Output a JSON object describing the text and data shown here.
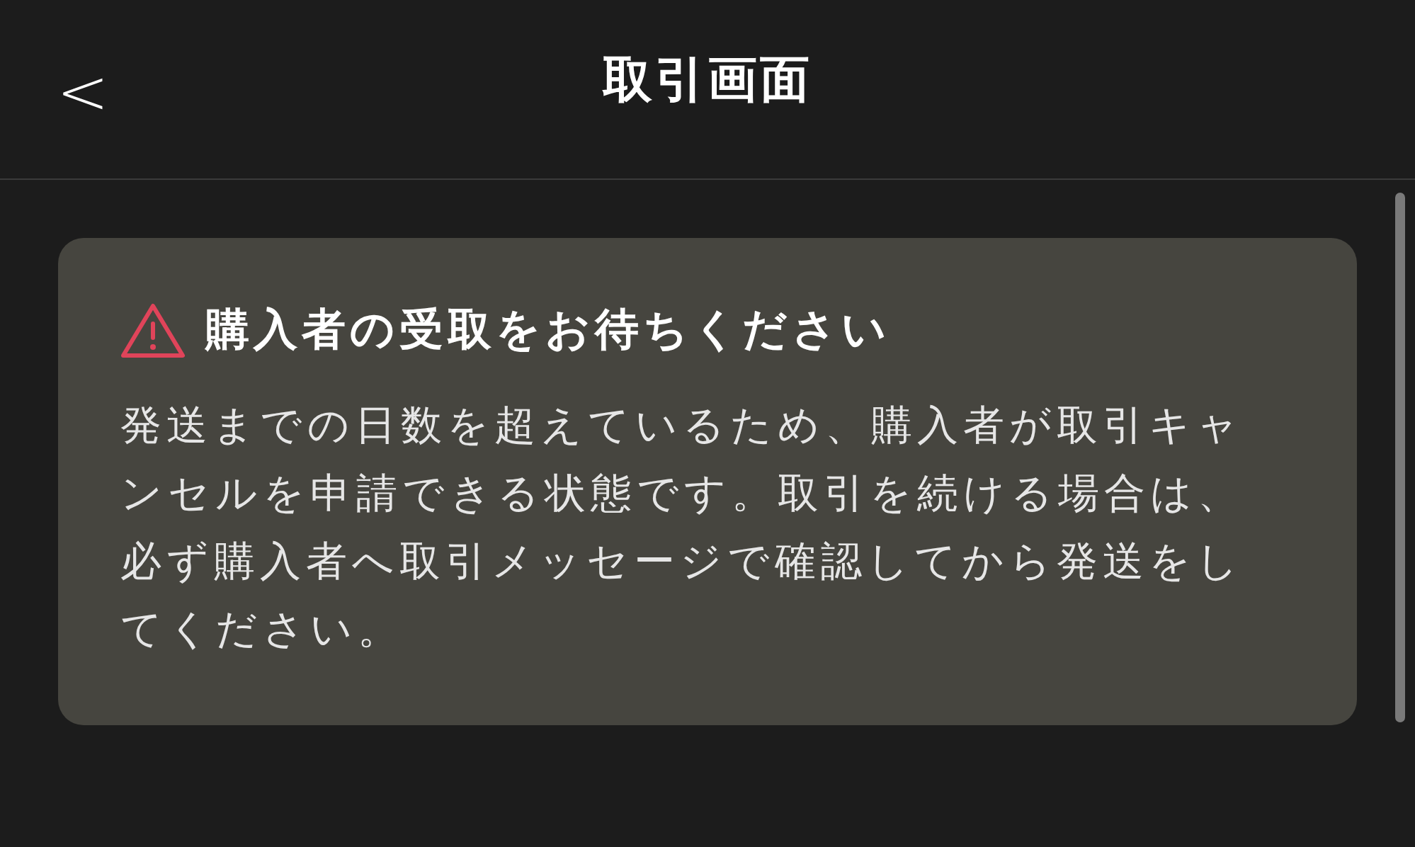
{
  "header": {
    "back": "<",
    "title": "取引画面"
  },
  "notice": {
    "kind": "warning",
    "title": "購入者の受取をお待ちください",
    "body": "発送までの日数を超えているため、購入者が取引キャンセルを申請できる状態です。取引を続ける場合は、必ず購入者へ取引メッセージで確認してから発送をしてください。"
  }
}
